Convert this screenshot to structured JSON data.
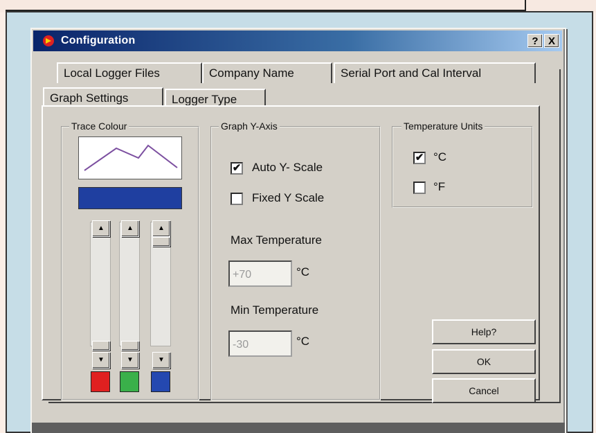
{
  "window": {
    "title": "Configuration",
    "help_btn": "?",
    "close_btn": "X"
  },
  "tabs": {
    "back_row": [
      "Local Logger Files",
      "Company Name",
      "Serial Port and Cal Interval"
    ],
    "front_row": [
      "Graph Settings",
      "Logger Type"
    ],
    "active": "Graph Settings"
  },
  "trace_colour": {
    "legend": "Trace Colour",
    "swatch_colour": "#1f3fa0",
    "sliders": [
      {
        "channel": "red",
        "color": "#e02020"
      },
      {
        "channel": "green",
        "color": "#3ab04a"
      },
      {
        "channel": "blue",
        "color": "#2448b0"
      }
    ]
  },
  "graph_y_axis": {
    "legend": "Graph  Y-Axis",
    "auto_scale_label": "Auto Y- Scale",
    "auto_scale_checked": true,
    "fixed_scale_label": "Fixed Y Scale",
    "fixed_scale_checked": false,
    "max_label": "Max Temperature",
    "max_value": "+70",
    "max_unit": "°C",
    "min_label": "Min Temperature",
    "min_value": "-30",
    "min_unit": "°C"
  },
  "temperature_units": {
    "legend": "Temperature Units",
    "celsius_label": "°C",
    "celsius_checked": true,
    "fahrenheit_label": "°F",
    "fahrenheit_checked": false
  },
  "buttons": {
    "help": "Help?",
    "ok": "OK",
    "cancel": "Cancel"
  },
  "check_glyph": "✔"
}
